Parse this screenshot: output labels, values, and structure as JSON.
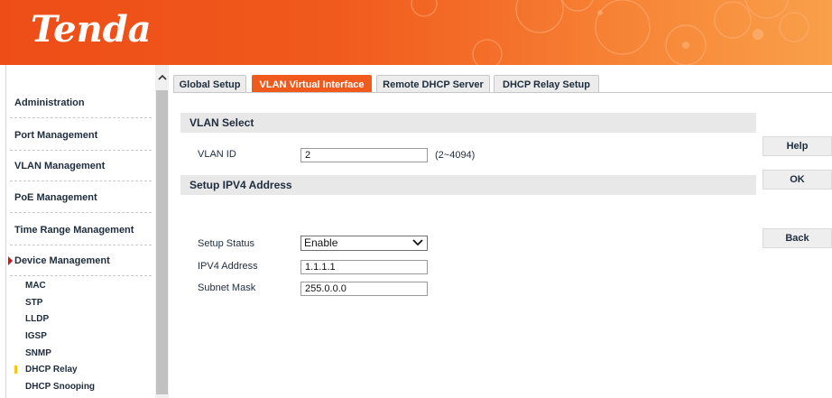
{
  "header": {
    "logo_text": "Tenda"
  },
  "sidebar": {
    "items": [
      {
        "label": "Administration"
      },
      {
        "label": "Port Management"
      },
      {
        "label": "VLAN Management"
      },
      {
        "label": "PoE Management"
      },
      {
        "label": "Time Range Management"
      },
      {
        "label": "Device Management",
        "expanded": true
      }
    ],
    "sub_items": [
      {
        "label": "MAC"
      },
      {
        "label": "STP"
      },
      {
        "label": "LLDP"
      },
      {
        "label": "IGSP"
      },
      {
        "label": "SNMP"
      },
      {
        "label": "DHCP Relay",
        "selected": true
      },
      {
        "label": "DHCP Snooping"
      }
    ]
  },
  "tabs": [
    {
      "label": "Global Setup"
    },
    {
      "label": "VLAN Virtual Interface",
      "active": true
    },
    {
      "label": "Remote DHCP Server"
    },
    {
      "label": "DHCP Relay Setup"
    }
  ],
  "vlan_select": {
    "title": "VLAN Select",
    "vlan_id_label": "VLAN ID",
    "vlan_id_value": "2",
    "vlan_id_hint": "(2~4094)"
  },
  "ipv4": {
    "title": "Setup IPV4 Address",
    "status_label": "Setup Status",
    "status_value": "Enable",
    "address_label": "IPV4 Address",
    "address_value": "1.1.1.1",
    "mask_label": "Subnet Mask",
    "mask_value": "255.0.0.0"
  },
  "buttons": {
    "help": "Help",
    "ok": "OK",
    "back": "Back"
  },
  "colors": {
    "accent": "#f05a1c",
    "active_marker": "#d0101a",
    "sub_marker": "#f7c51a"
  },
  "icons": {
    "scroll_up": "chevron-up-icon",
    "select_open": "chevron-down-icon",
    "expanded": "triangle-right-icon"
  }
}
